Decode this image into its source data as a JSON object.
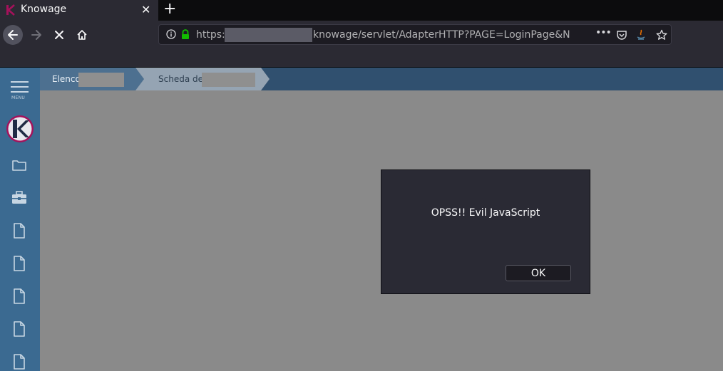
{
  "browser": {
    "tab_title": "Knowage",
    "tab_close": "✕",
    "new_tab": "+",
    "url_scheme": "https://",
    "url_path": "knowage/servlet/AdapterHTTP?PAGE=LoginPage&NE",
    "url_more": "•••"
  },
  "app": {
    "menu_label": "MENU",
    "breadcrumb": [
      {
        "label": "Elenco"
      },
      {
        "label": "Scheda del"
      }
    ]
  },
  "dialog": {
    "message": "OPSS!! Evil JavaScript",
    "ok_label": "OK"
  },
  "colors": {
    "sidebar": "#3b6a91",
    "brand_accent": "#a5115b"
  }
}
